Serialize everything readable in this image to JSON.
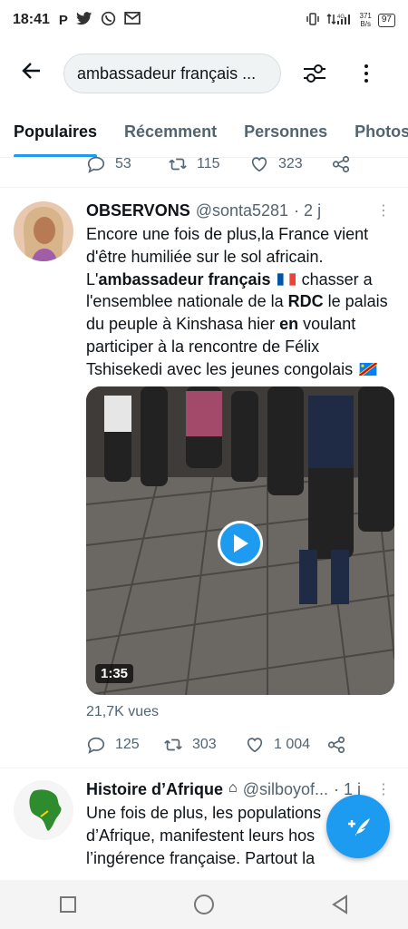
{
  "status_bar": {
    "time": "18:41",
    "icons": [
      "p-icon",
      "twitter-icon",
      "whatsapp-icon",
      "gmail-icon"
    ],
    "network": "4G",
    "speed_value": "371",
    "speed_unit": "B/s",
    "battery": "97"
  },
  "search": {
    "query": "ambassadeur français ..."
  },
  "tabs": [
    "Populaires",
    "Récemment",
    "Personnes",
    "Photos"
  ],
  "active_tab": 0,
  "prev_tweet_actions": {
    "replies": "53",
    "retweets": "115",
    "likes": "323"
  },
  "tweet1": {
    "name": "OBSERVONS",
    "handle": "@sonta5281",
    "time": "· 2 j",
    "text_parts": {
      "p1": "Encore une fois de plus,la France vient d'être humiliée sur le sol africain. L'",
      "b1": "ambassadeur français",
      "p2": " chasser a l'ensemblee nationale de la ",
      "b2": "RDC",
      "p3": " le palais du peuple à Kinshasa hier ",
      "b3": "en",
      "p4": " voulant participer à la rencontre de Félix Tshisekedi avec les jeunes congolais"
    },
    "video_duration": "1:35",
    "views": "21,7K vues",
    "replies": "125",
    "retweets": "303",
    "likes": "1 004"
  },
  "tweet2": {
    "name": "Histoire d’Afrique",
    "handle": "@silboyof...",
    "time": "· 1 j",
    "text": "Une fois de plus, les populations d’Afrique, manifestent leurs hos l’ingérence française. Partout la"
  },
  "colors": {
    "accent": "#1d9bf0",
    "text": "#0f1419",
    "secondary": "#536471"
  }
}
